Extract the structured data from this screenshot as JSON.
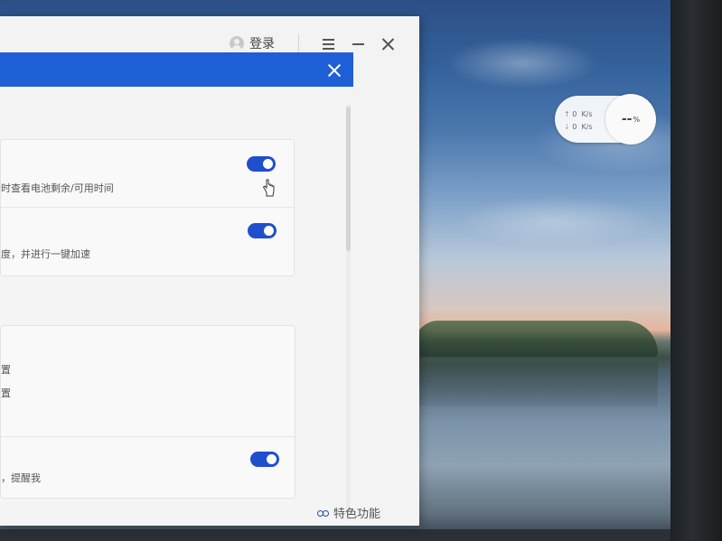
{
  "window": {
    "login_label": "登录"
  },
  "net_widget": {
    "upload": "0",
    "download": "0",
    "unit": "K/s",
    "percent_value": "--",
    "percent_sign": "%"
  },
  "settings": {
    "battery_desc": "时查看电池剩余/可用时间",
    "speedup_desc": "度，并进行一键加速",
    "line_a": "置",
    "line_b": "置",
    "reminder_desc": "，提醒我"
  },
  "footer": {
    "feature_label": "特色功能"
  },
  "colors": {
    "accent": "#1f5fd6",
    "toggle_on": "#1f4fcc"
  }
}
